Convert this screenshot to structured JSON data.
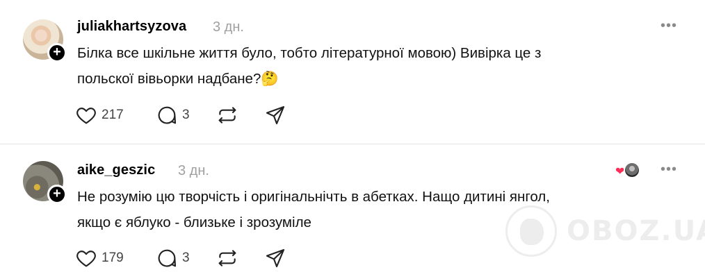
{
  "comments": [
    {
      "username": "juliakhartsyzova",
      "time": "3 дн.",
      "text_line1": "Білка все шкільне життя було, тобто літературної мовою) Вивірка це з",
      "text_line2": "польскої вівьорки надбане?🤔",
      "likes": "217",
      "replies": "3",
      "more": "•••",
      "follow": "+"
    },
    {
      "username": "aike_geszic",
      "time": "3 дн.",
      "text_line1": "Не розумію цю творчість і оригінальнічть в абетках. Нащо дитині янгол,",
      "text_line2": "якщо є яблуко - близьке і зрозуміле",
      "likes": "179",
      "replies": "3",
      "more": "•••",
      "follow": "+",
      "liked_by_heart": "❤"
    }
  ],
  "watermark": {
    "text": "OBOZ.UA"
  },
  "icons": {
    "like": "heart-icon",
    "reply": "comment-icon",
    "repost": "repost-icon",
    "share": "send-icon"
  },
  "colors": {
    "muted": "#a0a0a0",
    "liked_heart": "#ff2d55"
  }
}
